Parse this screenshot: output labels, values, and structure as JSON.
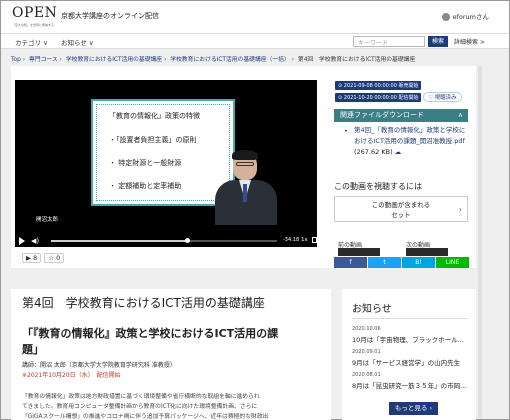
{
  "header": {
    "logo": "OPEN",
    "logo_sub": "「京大の知」を世界に発信する",
    "site_name": "京都大学講座のオンライン配信",
    "user": "eforumさん"
  },
  "nav": {
    "category": "カテゴリ ∨",
    "news": "お知らせ ∨",
    "search_placeholder": "キーワード",
    "search_btn": "検索",
    "advanced": "詳細検索 >"
  },
  "breadcrumb": [
    "Top",
    "専門コース",
    "学校教育におけるICT活用の基礎講座",
    "学校教育におけるICT活用の基礎講座（一括）",
    "第4回　学校教育におけるICT活用の基礎講座"
  ],
  "slide": {
    "title": "「教育の情報化」政策の特徴",
    "items": [
      "・「設置者負担主義」の原則",
      "・ 特定財源と一般財源",
      "・ 定額補助と定率補助"
    ]
  },
  "player": {
    "speaker": "開沼太郎",
    "time": "-34:18",
    "speed": "1x",
    "progress": 0.6
  },
  "actions": {
    "views": "▶ 8",
    "stars": "☆ 0"
  },
  "panel": {
    "date_publish": "⊙ 2021-09-08 00:00:00 販売開始",
    "date_deliver": "⊙ 2021-10-20 00:00:00 配信開始",
    "favorite": "♡ 視聴済み",
    "download_head": "関連ファイルダウンロード",
    "download_item": "第4回_「教育の情報化」政策と学校におけるICT活用の課題_開沼准教授.pdf",
    "download_size": "(267.62 KB)",
    "watch_head": "この動画を視聴するには",
    "set_line1": "この動画が含まれる",
    "set_line2": "セット",
    "prev": "前の動画",
    "next": "次の動画",
    "share": [
      "f",
      "t",
      "B!",
      "LINE"
    ]
  },
  "lecture": {
    "number": "第4回　学校教育におけるICT活用の基礎講座",
    "title1": "「『教育の情報化』政策と学校におけるICT活用の課",
    "title2": "題」",
    "instructor": "講師：開沼 太郎（京都大学大学院教育学研究科 准教授）",
    "date": "※2021年10月20日（水）　配信開始",
    "desc1": "「教育の情報化」政策は地方財政措置に基づく環境整備や省庁横断的な取組を軸に進められ",
    "desc2": "てきました。教育用コンピュータ整備計画から教育のICT化に向けた環境整備計画、さらに",
    "desc3": "「GIGAスクール構想」の推進やコロナ禍に伴う追加予算パッケージへ、近年は積極的な財政出"
  },
  "news": {
    "heading": "お知らせ",
    "items": [
      {
        "date": "2020.10.06",
        "text": "10月は「宇宙物理、ブラックホール..."
      },
      {
        "date": "2020.09.01",
        "text": "9月は「サービス経営学」の山内先生"
      },
      {
        "date": "2020.08.01",
        "text": "8月は「昆虫研究一筋３５年」の市岡..."
      }
    ],
    "more": "もっと見る ›"
  },
  "colors": {
    "navy": "#1e3a7b",
    "teal": "#3b7f86",
    "red": "#c0392b"
  }
}
